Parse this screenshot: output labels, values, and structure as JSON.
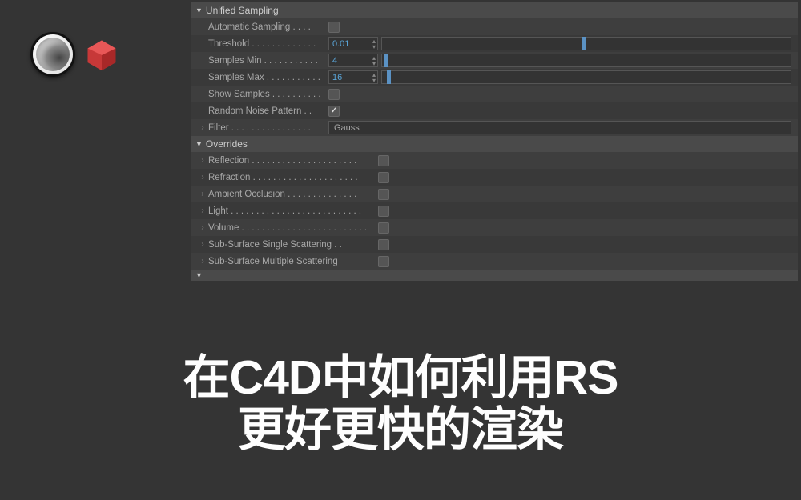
{
  "logos": {
    "c4d": "cinema-4d",
    "redshift": "redshift"
  },
  "unified_sampling": {
    "header": "Unified Sampling",
    "automatic_sampling": {
      "label": "Automatic Sampling",
      "checked": false
    },
    "threshold": {
      "label": "Threshold",
      "value": "0.01",
      "slider_pos": 0.49
    },
    "samples_min": {
      "label": "Samples Min",
      "value": "4",
      "slider_pos": 0.01
    },
    "samples_max": {
      "label": "Samples Max",
      "value": "16",
      "slider_pos": 0.015
    },
    "show_samples": {
      "label": "Show Samples",
      "checked": false
    },
    "random_noise": {
      "label": "Random Noise Pattern",
      "checked": true
    },
    "filter": {
      "label": "Filter",
      "value": "Gauss"
    }
  },
  "overrides": {
    "header": "Overrides",
    "items": [
      {
        "label": "Reflection",
        "checked": false
      },
      {
        "label": "Refraction",
        "checked": false
      },
      {
        "label": "Ambient Occlusion",
        "checked": false
      },
      {
        "label": "Light",
        "checked": false
      },
      {
        "label": "Volume",
        "checked": false
      },
      {
        "label": "Sub-Surface Single Scattering",
        "checked": false
      },
      {
        "label": "Sub-Surface Multiple Scattering",
        "checked": false
      }
    ]
  },
  "title": {
    "line1": "在C4D中如何利用RS",
    "line2": "更好更快的渲染"
  }
}
